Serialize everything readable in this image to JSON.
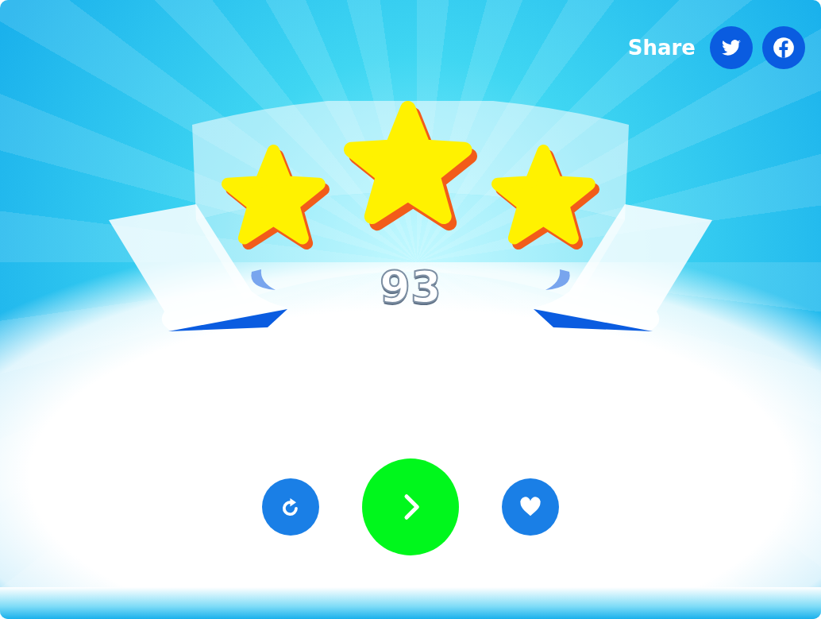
{
  "share": {
    "label": "Share",
    "buttons": [
      {
        "kind": "twitter"
      },
      {
        "kind": "facebook"
      }
    ]
  },
  "result": {
    "stars": 3,
    "score": "93"
  },
  "actions": [
    {
      "kind": "replay"
    },
    {
      "kind": "next"
    },
    {
      "kind": "like"
    }
  ]
}
